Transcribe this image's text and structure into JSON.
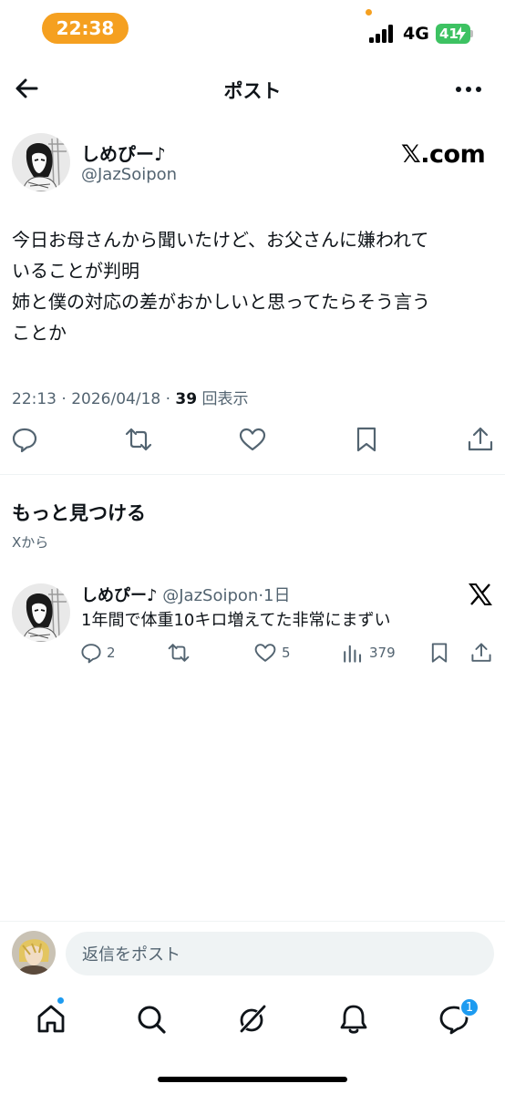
{
  "status_bar": {
    "time": "22:38",
    "network": "4G",
    "battery": "41"
  },
  "header": {
    "title": "ポスト",
    "back_icon": "arrow-left-icon",
    "more_icon": "more-horizontal-icon"
  },
  "main_post": {
    "author_name": "しめぴー♪",
    "handle": "@JazSoipon",
    "source_badge": "𝕏.com",
    "body_lines": [
      "今日お母さんから聞いたけど、お父さんに嫌われて",
      "いることが判明",
      "姉と僕の対応の差がおかしいと思ってたらそう言う",
      "ことか"
    ],
    "time": "22:13",
    "date": "2026/04/18",
    "views_count": "39",
    "views_label": "回表示",
    "actions": [
      "reply-icon",
      "repost-icon",
      "like-icon",
      "bookmark-icon",
      "share-icon"
    ]
  },
  "discover": {
    "title": "もっと見つける",
    "subtitle": "Xから"
  },
  "related_post": {
    "author_name": "しめぴー♪",
    "handle": "@JazSoipon",
    "age": "1日",
    "text": "1年間で体重10キロ増えてた非常にまずい",
    "replies": "2",
    "likes": "5",
    "views": "379"
  },
  "reply_bar": {
    "placeholder": "返信をポスト"
  },
  "bottom_nav": {
    "items": [
      "home-icon",
      "search-icon",
      "grok-icon",
      "notifications-icon",
      "messages-icon"
    ],
    "messages_badge": "1"
  },
  "colors": {
    "accent": "#1d9bf0",
    "time_pill": "#f5a020",
    "battery": "#3dc262",
    "secondary_text": "#536471"
  }
}
